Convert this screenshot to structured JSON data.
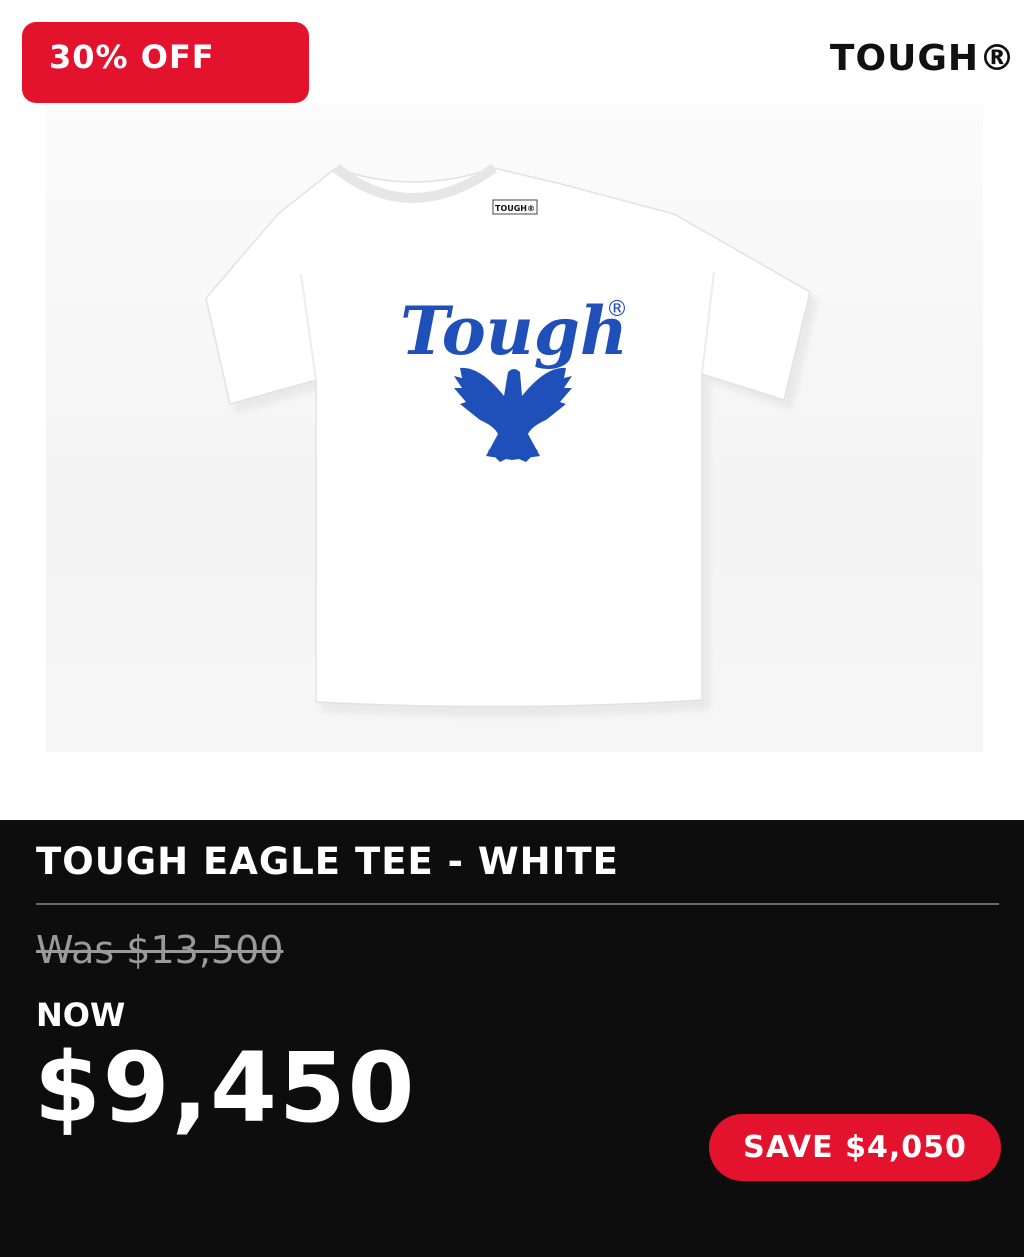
{
  "badge": {
    "discount": "30% OFF"
  },
  "brand": {
    "name": "TOUGH®"
  },
  "product": {
    "image": {
      "shirt_label": "TOUGH®",
      "print_text": "Tough",
      "print_mark": "®",
      "shirt_color": "#ffffff",
      "print_color": "#1f4fb8",
      "icon": "eagle-icon"
    },
    "name": "TOUGH EAGLE TEE - WHITE",
    "was_price": "Was $13,500",
    "now_label": "NOW",
    "now_price": "$9,450",
    "save": "SAVE $4,050"
  },
  "colors": {
    "accent": "#e3122d",
    "panel": "#0d0d0d"
  }
}
